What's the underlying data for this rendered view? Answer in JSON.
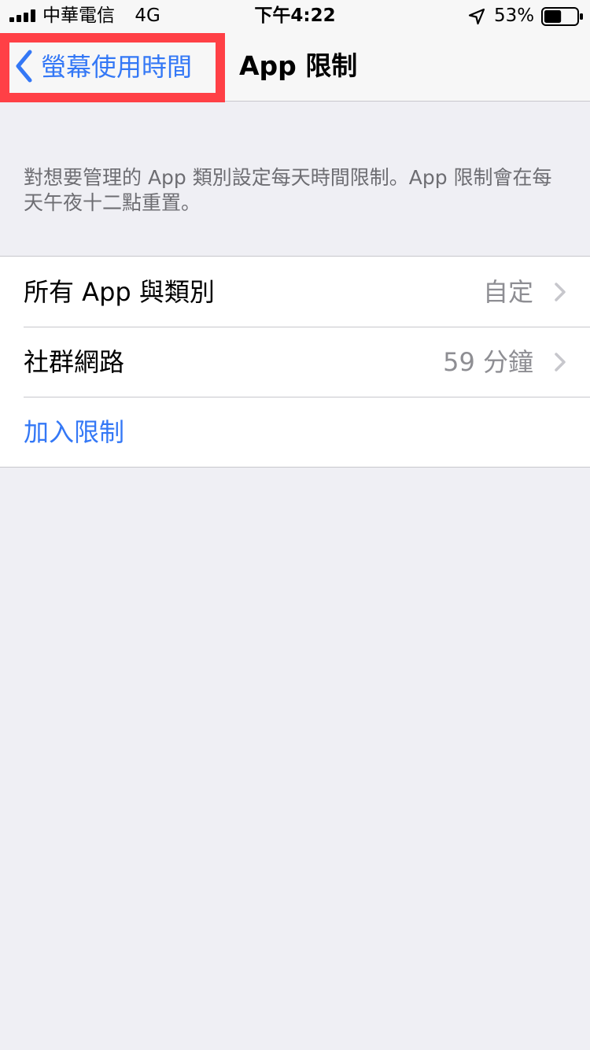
{
  "status_bar": {
    "carrier": "中華電信",
    "network": "4G",
    "time": "下午4:22",
    "battery_percent": "53%",
    "battery_level": 0.53,
    "icons": [
      "signal-icon",
      "location-icon",
      "battery-icon"
    ]
  },
  "nav_bar": {
    "back_label": "螢幕使用時間",
    "title": "App 限制"
  },
  "description": "對想要管理的 App 類別設定每天時間限制。App 限制會在每天午夜十二點重置。",
  "rows": [
    {
      "label": "所有 App 與類別",
      "value": "自定"
    },
    {
      "label": "社群網路",
      "value": "59 分鐘"
    }
  ],
  "add_limit_label": "加入限制",
  "colors": {
    "accent": "#3478f6",
    "highlight_border": "#ff4046",
    "background": "#efeff4",
    "secondary_text": "#8e8e93"
  }
}
